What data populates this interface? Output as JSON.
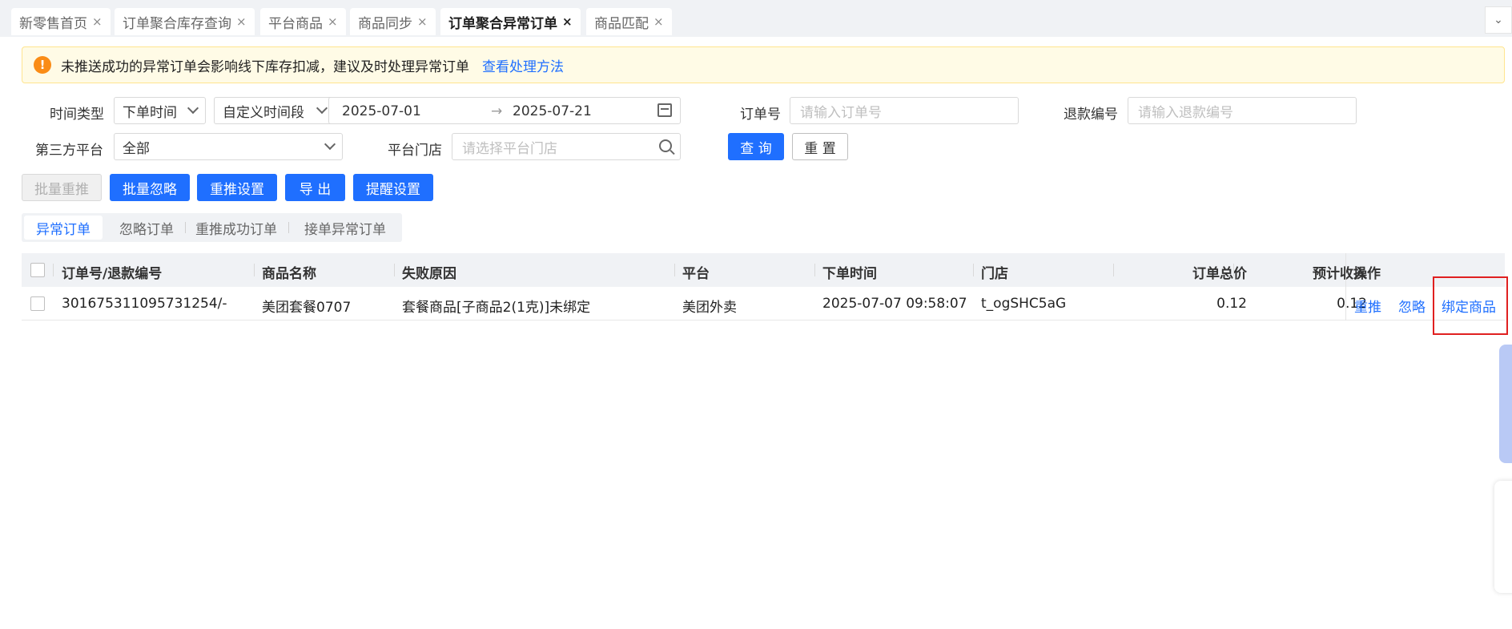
{
  "tabs": [
    {
      "label": "新零售首页",
      "close": "×"
    },
    {
      "label": "订单聚合库存查询",
      "close": "×"
    },
    {
      "label": "平台商品",
      "close": "×"
    },
    {
      "label": "商品同步",
      "close": "×"
    },
    {
      "label": "订单聚合异常订单",
      "close": "×",
      "active": true
    },
    {
      "label": "商品匹配",
      "close": "×"
    }
  ],
  "tabs_dropdown_glyph": "⌄",
  "alert": {
    "icon_glyph": "!",
    "text": "未推送成功的异常订单会影响线下库存扣减，建议及时处理异常订单",
    "link": "查看处理方法"
  },
  "filters": {
    "time_type_label": "时间类型",
    "time_type_value": "下单时间",
    "period_value": "自定义时间段",
    "date_start": "2025-07-01",
    "date_sep": "→",
    "date_end": "2025-07-21",
    "order_no_label": "订单号",
    "order_no_placeholder": "请输入订单号",
    "refund_no_label": "退款编号",
    "refund_no_placeholder": "请输入退款编号",
    "platform_label": "第三方平台",
    "platform_value": "全部",
    "store_label": "平台门店",
    "store_placeholder": "请选择平台门店",
    "query_button": "查 询",
    "reset_button": "重 置"
  },
  "actions": {
    "batch_repush": "批量重推",
    "batch_ignore": "批量忽略",
    "repush_settings": "重推设置",
    "export": "导 出",
    "reminder_settings": "提醒设置"
  },
  "subtabs": [
    "异常订单",
    "忽略订单",
    "重推成功订单",
    "接单异常订单"
  ],
  "table": {
    "headers": [
      "订单号/退款编号",
      "商品名称",
      "失败原因",
      "平台",
      "下单时间",
      "门店",
      "订单总价",
      "预计收入",
      "操作"
    ],
    "rows": [
      {
        "order_no": "301675311095731254/-",
        "product": "美团套餐0707",
        "reason": "套餐商品[子商品2(1克)]未绑定",
        "platform": "美团外卖",
        "order_time": "2025-07-07 09:58:07",
        "store": "t_ogSHC5aG",
        "total": "0.12",
        "income": "0.12",
        "ops": [
          "重推",
          "忽略",
          "绑定商品"
        ]
      }
    ]
  },
  "colors": {
    "primary": "#1f6fff",
    "alert_bg": "#fffbe6",
    "alert_icon": "#fa8c16",
    "highlight": "#e02020"
  }
}
